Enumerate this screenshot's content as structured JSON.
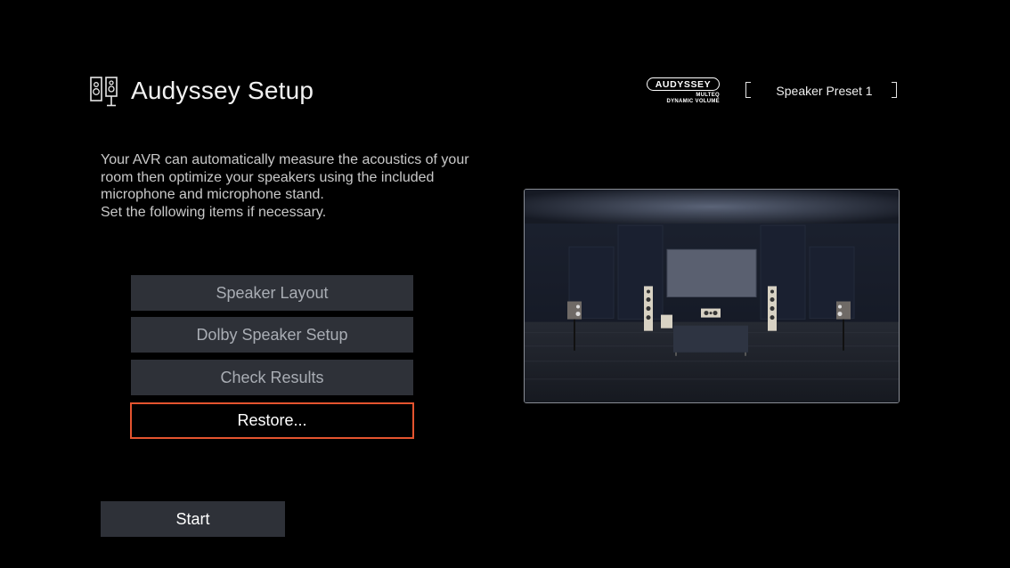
{
  "header": {
    "title": "Audyssey Setup",
    "icon": "speakers-icon"
  },
  "logo": {
    "brand": "AUDYSSEY",
    "line1": "MULTEQ",
    "line2": "DYNAMIC VOLUME"
  },
  "preset": {
    "label": "Speaker Preset 1"
  },
  "description": {
    "line1": "Your AVR can automatically measure the acoustics of your room then optimize your speakers using the included microphone and microphone stand.",
    "line2": "Set the following items if necessary."
  },
  "menu": {
    "items": [
      {
        "label": "Speaker Layout"
      },
      {
        "label": "Dolby Speaker Setup"
      },
      {
        "label": "Check Results"
      },
      {
        "label": "Restore..."
      }
    ],
    "selected": "Restore..."
  },
  "start": {
    "label": "Start"
  },
  "colors": {
    "background": "#000000",
    "button": "#2e3138",
    "focus_border": "#e4542f",
    "text": "#e6e6e6"
  }
}
